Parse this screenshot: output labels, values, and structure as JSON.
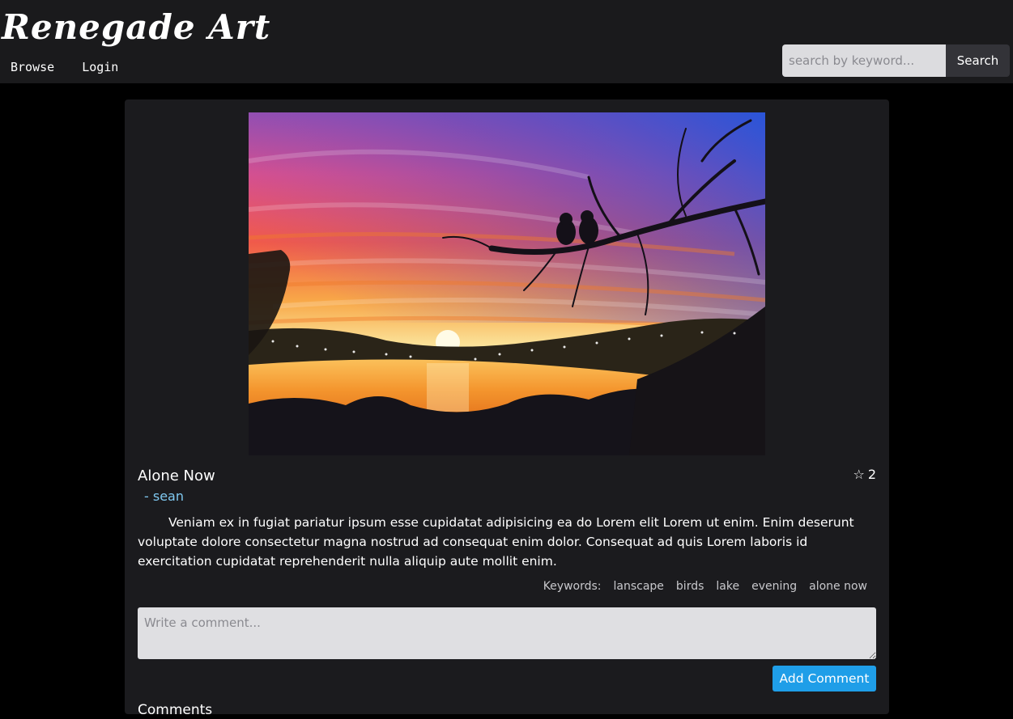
{
  "app": {
    "logo": "Renegade Art"
  },
  "nav": {
    "browse": "Browse",
    "login": "Login"
  },
  "search": {
    "placeholder": "search by keyword...",
    "button": "Search"
  },
  "artwork": {
    "title": "Alone Now",
    "author": "- sean",
    "stars": "2",
    "star_icon": "star-outline-icon",
    "description": "Veniam ex in fugiat pariatur ipsum esse cupidatat adipisicing ea do Lorem elit Lorem ut enim. Enim deserunt voluptate dolore consectetur magna nostrud ad consequat enim dolor. Consequat ad quis Lorem laboris id exercitation cupidatat reprehenderit nulla aliquip aute mollit enim.",
    "keywords_label": "Keywords:",
    "keywords": [
      "lanscape",
      "birds",
      "lake",
      "evening",
      "alone now"
    ]
  },
  "comment": {
    "placeholder": "Write a comment...",
    "button": "Add Comment"
  },
  "comments": {
    "heading": "Comments"
  },
  "colors": {
    "topbar": "#1a1a1c",
    "card": "#1b1b1e",
    "accent": "#1f9ee8",
    "author": "#7fc8f0"
  }
}
